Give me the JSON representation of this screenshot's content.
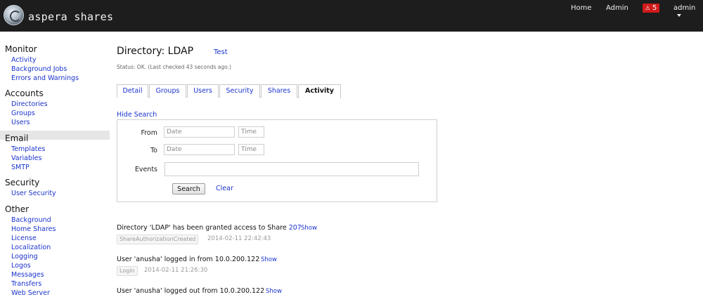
{
  "topbar": {
    "brand": "aspera shares",
    "home": "Home",
    "admin": "Admin",
    "alert_icon": "warning-icon",
    "alert_count": "5",
    "user": "admin"
  },
  "sidebar": {
    "monitor": {
      "title": "Monitor",
      "items": [
        "Activity",
        "Background Jobs",
        "Errors and Warnings"
      ]
    },
    "accounts": {
      "title": "Accounts",
      "items": [
        "Directories",
        "Groups",
        "Users"
      ]
    },
    "email": {
      "title": "Email",
      "items": [
        "Templates",
        "Variables",
        "SMTP"
      ]
    },
    "security": {
      "title": "Security",
      "items": [
        "User Security"
      ]
    },
    "other": {
      "title": "Other",
      "items": [
        "Background",
        "Home Shares",
        "License",
        "Localization",
        "Logging",
        "Logos",
        "Messages",
        "Transfers",
        "Web Server"
      ]
    },
    "active_item": "Directories"
  },
  "main": {
    "title": "Directory: LDAP",
    "test_link": "Test",
    "status": "Status: OK. (Last checked 43 seconds ago.)",
    "tabs": [
      "Detail",
      "Groups",
      "Users",
      "Security",
      "Shares",
      "Activity"
    ],
    "active_tab": "Activity"
  },
  "search": {
    "toggle": "Hide Search",
    "from_label": "From",
    "to_label": "To",
    "events_label": "Events",
    "date_placeholder": "Date",
    "time_placeholder": "Time",
    "events_value": "",
    "search_button": "Search",
    "clear_link": "Clear"
  },
  "activity": [
    {
      "text": "Directory 'LDAP' has been granted access to Share ",
      "link": "207",
      "show": "Show",
      "tag": "ShareAuthorizationCreated",
      "timestamp": "2014-02-11 22:42:43"
    },
    {
      "text": "User 'anusha' logged in from 10.0.200.122",
      "link": "",
      "show": "Show",
      "tag": "Login",
      "timestamp": "2014-02-11 21:26:30"
    },
    {
      "text": "User 'anusha' logged out from 10.0.200.122",
      "link": "",
      "show": "Show",
      "tag": "",
      "timestamp": ""
    }
  ],
  "colors": {
    "topbar": "#1d1d1d",
    "link": "#1a33cc",
    "alert": "#d11a1a"
  }
}
